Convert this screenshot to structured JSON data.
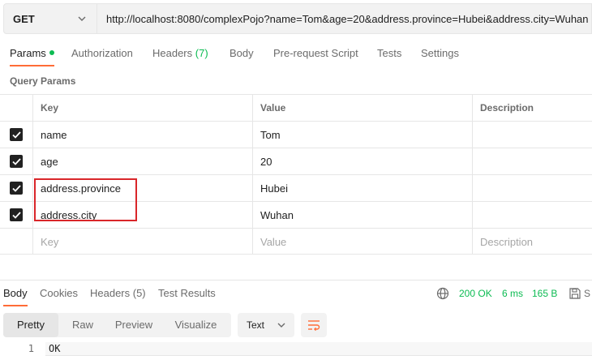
{
  "request": {
    "method": "GET",
    "url": "http://localhost:8080/complexPojo?name=Tom&age=20&address.province=Hubei&address.city=Wuhan"
  },
  "tabs": {
    "params": "Params",
    "authorization": "Authorization",
    "headers": "Headers",
    "headers_count": "(7)",
    "body": "Body",
    "prerequest": "Pre-request Script",
    "tests": "Tests",
    "settings": "Settings"
  },
  "query_params": {
    "title": "Query Params",
    "columns": [
      "Key",
      "Value",
      "Description"
    ],
    "rows": [
      {
        "key": "name",
        "value": "Tom",
        "description": ""
      },
      {
        "key": "age",
        "value": "20",
        "description": ""
      },
      {
        "key": "address.province",
        "value": "Hubei",
        "description": ""
      },
      {
        "key": "address.city",
        "value": "Wuhan",
        "description": ""
      }
    ],
    "placeholder": {
      "key": "Key",
      "value": "Value",
      "description": "Description"
    }
  },
  "response": {
    "tabs": {
      "body": "Body",
      "cookies": "Cookies",
      "headers": "Headers (5)",
      "test_results": "Test Results"
    },
    "status": "200 OK",
    "time": "6 ms",
    "size": "165 B",
    "save_label": "S",
    "views": [
      "Pretty",
      "Raw",
      "Preview",
      "Visualize"
    ],
    "format": "Text",
    "line_number": "1",
    "body_text": "OK"
  },
  "colors": {
    "accent": "#ff6c37",
    "success": "#0cbb52",
    "highlight_box": "#d9262a"
  }
}
